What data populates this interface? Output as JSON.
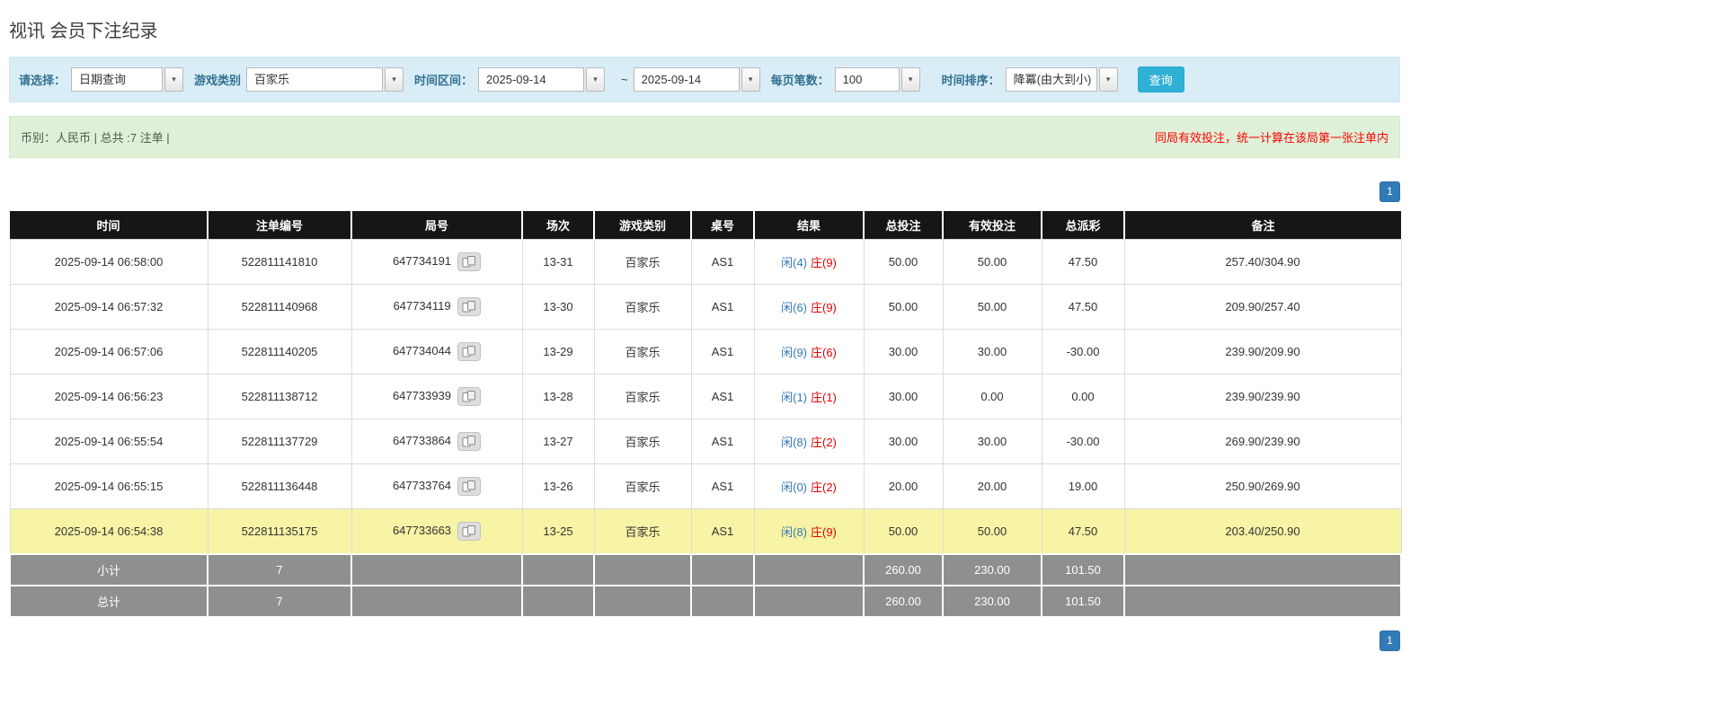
{
  "page": {
    "title": "视讯 会员下注纪录"
  },
  "colors": {
    "filter_bg": "#d9edf7",
    "filter_label": "#31708f",
    "info_bg": "#dff0d8",
    "notice_red": "#ff0000",
    "header_bg": "#161616",
    "row_highlight": "#f7f4a5",
    "summary_bg": "#8f8f8f",
    "link_blue": "#337ab7",
    "player_blue": "#337ab7",
    "banker_red": "#e60000",
    "negative_red": "#e60000",
    "search_btn": "#31b0d5",
    "pager_blue": "#337ab7"
  },
  "icons": {
    "combo_arrow": "▾",
    "round_detail": "cards-icon"
  },
  "filters": {
    "select_label": "请选择：",
    "select_value": "日期查询",
    "game_type_label": "游戏类别",
    "game_type_value": "百家乐",
    "date_range_label": "时间区间：",
    "date_from": "2025-09-14",
    "date_separator": "~",
    "date_to": "2025-09-14",
    "page_size_label": "每页笔数：",
    "page_size_value": "100",
    "sort_label": "时间排序：",
    "sort_value": "降冪(由大到小)",
    "search_button": "查询"
  },
  "summary_bar": {
    "left_text": "币别：人民币 | 总共 :7 注单 |",
    "right_notice": "同局有效投注，统一计算在该局第一张注单内"
  },
  "pagination": {
    "page": "1"
  },
  "table": {
    "headers": [
      "时间",
      "注单编号",
      "局号",
      "场次",
      "游戏类别",
      "桌号",
      "结果",
      "总投注",
      "有效投注",
      "总派彩",
      "备注"
    ],
    "rows": [
      {
        "time": "2025-09-14 06:58:00",
        "bet_id": "522811141810",
        "round_no": "647734191",
        "session": "13-31",
        "game_type": "百家乐",
        "table_no": "AS1",
        "result_player": "闲(4)",
        "result_banker": "庄(9)",
        "total_bet": "50.00",
        "valid_bet": "50.00",
        "payout": "47.50",
        "remark": "257.40/304.90",
        "highlighted": false
      },
      {
        "time": "2025-09-14 06:57:32",
        "bet_id": "522811140968",
        "round_no": "647734119",
        "session": "13-30",
        "game_type": "百家乐",
        "table_no": "AS1",
        "result_player": "闲(6)",
        "result_banker": "庄(9)",
        "total_bet": "50.00",
        "valid_bet": "50.00",
        "payout": "47.50",
        "remark": "209.90/257.40",
        "highlighted": false
      },
      {
        "time": "2025-09-14 06:57:06",
        "bet_id": "522811140205",
        "round_no": "647734044",
        "session": "13-29",
        "game_type": "百家乐",
        "table_no": "AS1",
        "result_player": "闲(9)",
        "result_banker": "庄(6)",
        "total_bet": "30.00",
        "valid_bet": "30.00",
        "payout": "-30.00",
        "remark": "239.90/209.90",
        "highlighted": false
      },
      {
        "time": "2025-09-14 06:56:23",
        "bet_id": "522811138712",
        "round_no": "647733939",
        "session": "13-28",
        "game_type": "百家乐",
        "table_no": "AS1",
        "result_player": "闲(1)",
        "result_banker": "庄(1)",
        "total_bet": "30.00",
        "valid_bet": "0.00",
        "payout": "0.00",
        "remark": "239.90/239.90",
        "highlighted": false
      },
      {
        "time": "2025-09-14 06:55:54",
        "bet_id": "522811137729",
        "round_no": "647733864",
        "session": "13-27",
        "game_type": "百家乐",
        "table_no": "AS1",
        "result_player": "闲(8)",
        "result_banker": "庄(2)",
        "total_bet": "30.00",
        "valid_bet": "30.00",
        "payout": "-30.00",
        "remark": "269.90/239.90",
        "highlighted": false
      },
      {
        "time": "2025-09-14 06:55:15",
        "bet_id": "522811136448",
        "round_no": "647733764",
        "session": "13-26",
        "game_type": "百家乐",
        "table_no": "AS1",
        "result_player": "闲(0)",
        "result_banker": "庄(2)",
        "total_bet": "20.00",
        "valid_bet": "20.00",
        "payout": "19.00",
        "remark": "250.90/269.90",
        "highlighted": false
      },
      {
        "time": "2025-09-14 06:54:38",
        "bet_id": "522811135175",
        "round_no": "647733663",
        "session": "13-25",
        "game_type": "百家乐",
        "table_no": "AS1",
        "result_player": "闲(8)",
        "result_banker": "庄(9)",
        "total_bet": "50.00",
        "valid_bet": "50.00",
        "payout": "47.50",
        "remark": "203.40/250.90",
        "highlighted": true
      }
    ],
    "subtotal": {
      "label": "小计",
      "count": "7",
      "total_bet": "260.00",
      "valid_bet": "230.00",
      "payout": "101.50"
    },
    "total": {
      "label": "总计",
      "count": "7",
      "total_bet": "260.00",
      "valid_bet": "230.00",
      "payout": "101.50"
    }
  }
}
